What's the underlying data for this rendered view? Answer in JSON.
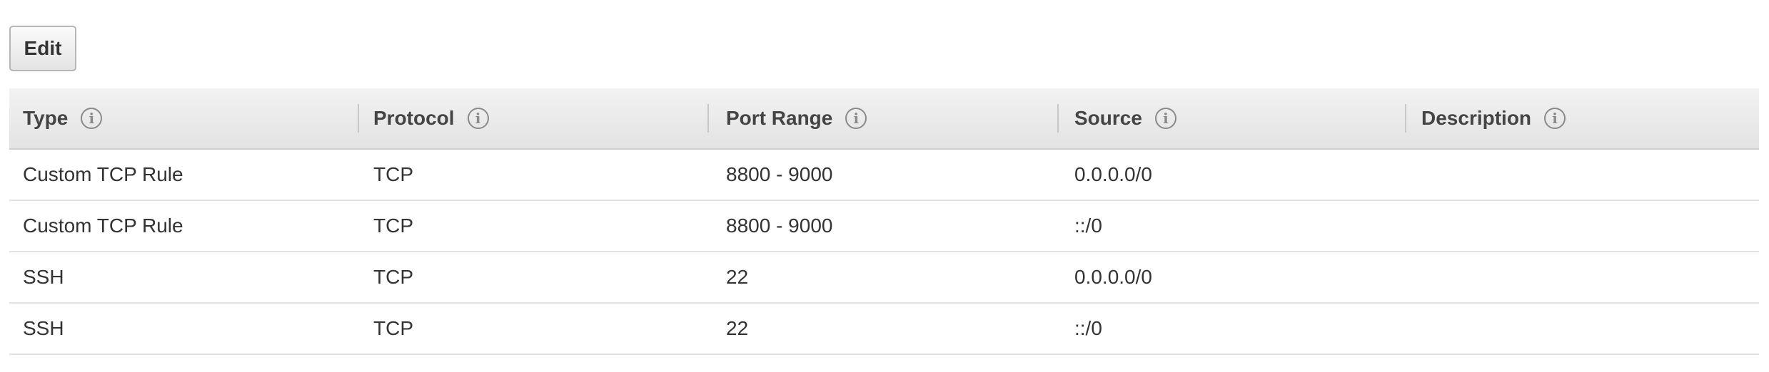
{
  "toolbar": {
    "edit_label": "Edit"
  },
  "table": {
    "columns": [
      {
        "label": "Type",
        "icon": "info-icon"
      },
      {
        "label": "Protocol",
        "icon": "info-icon"
      },
      {
        "label": "Port Range",
        "icon": "info-icon"
      },
      {
        "label": "Source",
        "icon": "info-icon"
      },
      {
        "label": "Description",
        "icon": "info-icon"
      }
    ],
    "rows": [
      {
        "type": "Custom TCP Rule",
        "protocol": "TCP",
        "port_range": "8800 - 9000",
        "source": "0.0.0.0/0",
        "description": ""
      },
      {
        "type": "Custom TCP Rule",
        "protocol": "TCP",
        "port_range": "8800 - 9000",
        "source": "::/0",
        "description": ""
      },
      {
        "type": "SSH",
        "protocol": "TCP",
        "port_range": "22",
        "source": "0.0.0.0/0",
        "description": ""
      },
      {
        "type": "SSH",
        "protocol": "TCP",
        "port_range": "22",
        "source": "::/0",
        "description": ""
      }
    ]
  }
}
